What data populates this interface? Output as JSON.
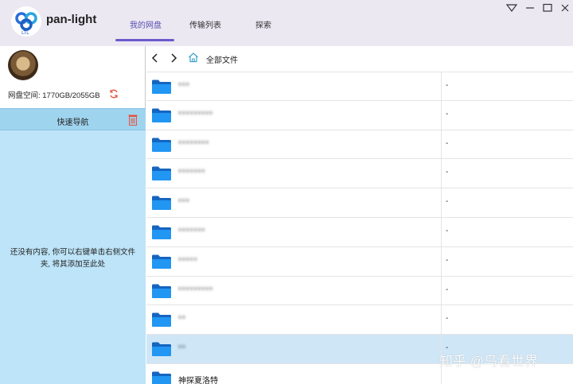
{
  "app": {
    "title": "pan-light"
  },
  "tabs": [
    {
      "label": "我的网盘",
      "active": true
    },
    {
      "label": "传输列表",
      "active": false
    },
    {
      "label": "探索",
      "active": false
    }
  ],
  "window_controls": [
    "filter-icon",
    "minimize-icon",
    "maximize-icon",
    "close-icon"
  ],
  "sidebar": {
    "storage_text": "网盘空间: 1770GB/2055GB",
    "quick_nav_label": "快速导航",
    "empty_message": "还没有内容, 你可以右键单击右侧文件夹, 将其添加至此处"
  },
  "pathbar": {
    "current_path": "全部文件"
  },
  "files": [
    {
      "name": "***",
      "size": "-",
      "blurred": true,
      "selected": false
    },
    {
      "name": "*********",
      "size": "-",
      "blurred": true,
      "selected": false
    },
    {
      "name": "********",
      "size": "-",
      "blurred": true,
      "selected": false
    },
    {
      "name": "*******",
      "size": "-",
      "blurred": true,
      "selected": false
    },
    {
      "name": "***",
      "size": "-",
      "blurred": true,
      "selected": false
    },
    {
      "name": "*******",
      "size": "-",
      "blurred": true,
      "selected": false
    },
    {
      "name": "*****",
      "size": "-",
      "blurred": true,
      "selected": false
    },
    {
      "name": "*********",
      "size": "-",
      "blurred": true,
      "selected": false
    },
    {
      "name": "**",
      "size": "-",
      "blurred": true,
      "selected": false
    },
    {
      "name": "**",
      "size": "-",
      "blurred": true,
      "selected": true
    },
    {
      "name": "神探夏洛特",
      "size": "",
      "blurred": false,
      "selected": false
    }
  ],
  "watermark": {
    "text": "知乎 @鸟看世界"
  },
  "colors": {
    "accent": "#6a5acd",
    "nav_bg": "#bde4f8",
    "quick_nav_bg": "#9fd4ef",
    "folder": "#1e88e5",
    "selected_row": "#cfe6f7"
  }
}
